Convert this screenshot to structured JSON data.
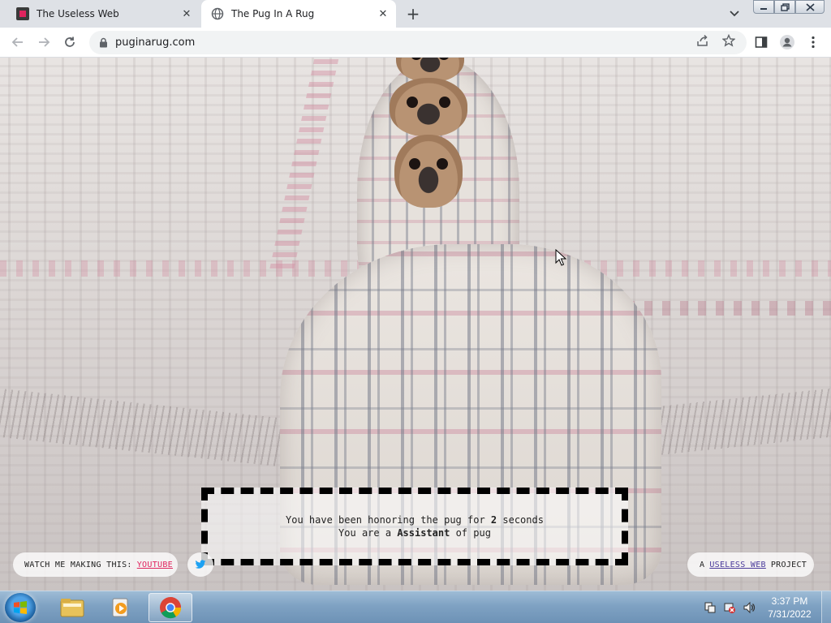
{
  "browser": {
    "tabs": [
      {
        "title": "The Useless Web",
        "favicon": "useless-web-favicon",
        "active": false
      },
      {
        "title": "The Pug In A Rug",
        "favicon": "globe-icon",
        "active": true
      }
    ],
    "new_tab_label": "+",
    "address": "puginarug.com"
  },
  "page": {
    "counter": {
      "line1_prefix": "You have been honoring the pug for",
      "seconds": "2",
      "line1_suffix": "seconds",
      "line2_prefix": "You are a",
      "rank": "Assistant",
      "line2_suffix": "of pug"
    },
    "watch": {
      "label": "WATCH ME MAKING THIS:",
      "link": "YOUTUBE"
    },
    "project": {
      "prefix": "A",
      "link": "USELESS WEB",
      "suffix": "PROJECT"
    }
  },
  "taskbar": {
    "time": "3:37 PM",
    "date": "7/31/2022"
  },
  "colors": {
    "link_pink": "#e0245e",
    "link_purple": "#4b3b9b",
    "taskbar": "#7fa2c3"
  }
}
